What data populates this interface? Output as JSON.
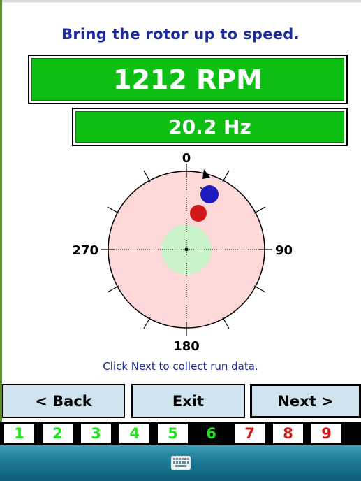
{
  "instruction": "Bring the rotor up to speed.",
  "readouts": {
    "rpm": "1212 RPM",
    "hz": "20.2 Hz"
  },
  "polar": {
    "labels": {
      "top": "0",
      "right": "90",
      "bottom": "180",
      "left": "270"
    },
    "colors": {
      "field": "#fdd8d8",
      "target": "#c9f2c9",
      "marker_current": "#1c1cc0",
      "marker_previous": "#d01818"
    }
  },
  "hint": "Click Next to collect run data.",
  "buttons": {
    "back": "< Back",
    "exit": "Exit",
    "next": "Next >"
  },
  "steps": [
    {
      "label": "1",
      "state": "done"
    },
    {
      "label": "2",
      "state": "done"
    },
    {
      "label": "3",
      "state": "done"
    },
    {
      "label": "4",
      "state": "done"
    },
    {
      "label": "5",
      "state": "done"
    },
    {
      "label": "6",
      "state": "current"
    },
    {
      "label": "7",
      "state": "todo"
    },
    {
      "label": "8",
      "state": "todo"
    },
    {
      "label": "9",
      "state": "todo"
    }
  ],
  "taskbar": {
    "keyboard_icon": "keyboard-icon"
  }
}
